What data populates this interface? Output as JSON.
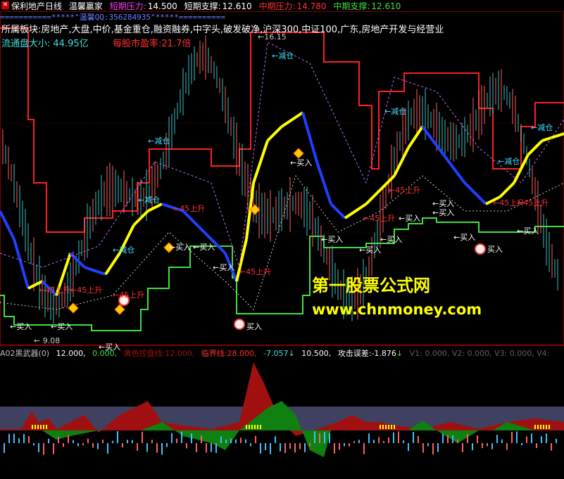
{
  "title_bar": {
    "stock_name": "保利地产",
    "period": "日线",
    "formula_name": "温馨赢家",
    "short_pressure_label": "短期压力:",
    "short_pressure_value": "14.500",
    "short_support_label": "短期支撑:",
    "short_support_value": "12.610",
    "mid_pressure_label": "中期压力:",
    "mid_pressure_value": "14.780",
    "mid_support_label": "中期支撑:",
    "mid_support_value": "12.610"
  },
  "stars_line": "===========*****\"温馨QQ:356284935\"*****==========",
  "sector_line": "所属板块:房地产,大盘,中价,基金重仓,融资融券,中字头,破发破净,沪深300,中证100,广东,房地产开发与经营业",
  "float_cap_label": "流通盘大小:",
  "float_cap_value": "44.95亿",
  "pe_label": "每股市盈率:",
  "pe_value": "21.7倍",
  "price_high_marker": "16.15",
  "price_low_marker": "9.08",
  "annotations": {
    "reduce": "减仓",
    "buy": "买入",
    "rise45": "45上升"
  },
  "indicator_header": {
    "name": "A02黑武器(0)",
    "v1": "12.000,",
    "v2": "0.000,",
    "yellow_line_label": "黄色控盘线:",
    "yellow_line_value": "12.000,",
    "critical_label": "临界线:",
    "critical_value": "28.000,",
    "v3": "-7.057",
    "v3_arrow": "↓",
    "v4": "10.500,",
    "attack_label": "攻击误差:",
    "attack_value": "-1.876",
    "attack_arrow": "↓",
    "extra": "V1: 0.000, V2: 0.000, V3: 0.000, V4:"
  },
  "watermark": {
    "line1": "第一股票公式网",
    "line2": "www.chnmoney.com"
  },
  "colors": {
    "resistance": "#ff2020",
    "support": "#40e040",
    "up_trend": "#ffff00",
    "down_trend": "#2040ff",
    "lavender": "#c070ff",
    "red_fill": "#a01010",
    "green_fill": "#108010"
  }
}
